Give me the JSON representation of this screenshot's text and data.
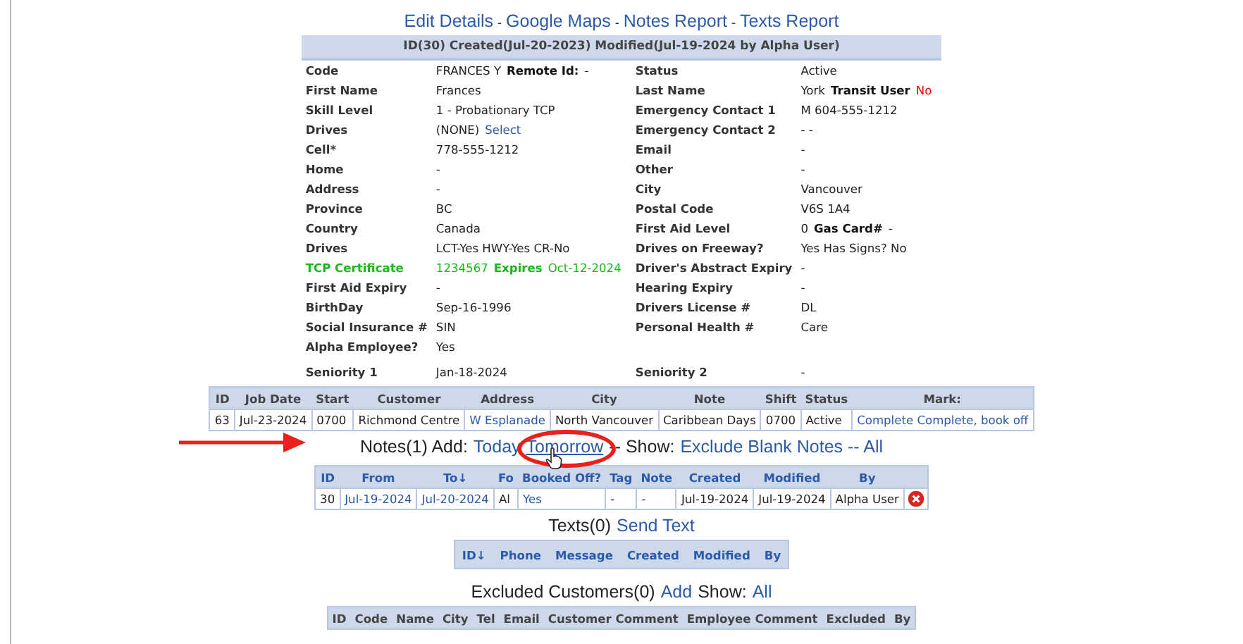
{
  "top_links": [
    "Edit Details",
    "Google Maps",
    "Notes Report",
    "Texts Report"
  ],
  "link_separator": "-",
  "detail": {
    "header": "ID(30) Created(Jul-20-2023) Modified(Jul-19-2024 by Alpha User)",
    "rows": [
      {
        "fields": [
          {
            "label": "Code",
            "highlight": false,
            "parts": [
              {
                "text": "FRANCES Y",
                "kind": "plain"
              },
              {
                "text": "Remote Id:",
                "kind": "bold"
              },
              {
                "text": "-",
                "kind": "plain"
              }
            ]
          },
          {
            "label": "Status",
            "highlight": false,
            "parts": [
              {
                "text": "Active",
                "kind": "plain"
              }
            ]
          }
        ]
      },
      {
        "fields": [
          {
            "label": "First Name",
            "highlight": false,
            "parts": [
              {
                "text": "Frances",
                "kind": "plain"
              }
            ]
          },
          {
            "label": "Last Name",
            "highlight": false,
            "parts": [
              {
                "text": "York",
                "kind": "plain"
              },
              {
                "text": "Transit User",
                "kind": "bold"
              },
              {
                "text": "No",
                "kind": "alert"
              }
            ]
          }
        ]
      },
      {
        "fields": [
          {
            "label": "Skill Level",
            "highlight": false,
            "parts": [
              {
                "text": "1 - Probationary TCP",
                "kind": "plain"
              }
            ]
          },
          {
            "label": "Emergency Contact 1",
            "highlight": false,
            "parts": [
              {
                "text": "M 604-555-1212",
                "kind": "plain"
              }
            ]
          }
        ]
      },
      {
        "fields": [
          {
            "label": "Drives",
            "highlight": false,
            "parts": [
              {
                "text": "(NONE)",
                "kind": "plain"
              },
              {
                "text": "Select",
                "kind": "link"
              }
            ]
          },
          {
            "label": "Emergency Contact 2",
            "highlight": false,
            "parts": [
              {
                "text": "- -",
                "kind": "plain"
              }
            ]
          }
        ]
      },
      {
        "fields": [
          {
            "label": "Cell*",
            "highlight": false,
            "parts": [
              {
                "text": "778-555-1212",
                "kind": "plain"
              }
            ]
          },
          {
            "label": "Email",
            "highlight": false,
            "parts": [
              {
                "text": "-",
                "kind": "plain"
              }
            ]
          }
        ]
      },
      {
        "fields": [
          {
            "label": "Home",
            "highlight": false,
            "parts": [
              {
                "text": "-",
                "kind": "plain"
              }
            ]
          },
          {
            "label": "Other",
            "highlight": false,
            "parts": [
              {
                "text": "-",
                "kind": "plain"
              }
            ]
          }
        ]
      },
      {
        "fields": [
          {
            "label": "Address",
            "highlight": false,
            "parts": [
              {
                "text": "-",
                "kind": "plain"
              }
            ]
          },
          {
            "label": "City",
            "highlight": false,
            "parts": [
              {
                "text": "Vancouver",
                "kind": "plain"
              }
            ]
          }
        ]
      },
      {
        "fields": [
          {
            "label": "Province",
            "highlight": false,
            "parts": [
              {
                "text": "BC",
                "kind": "plain"
              }
            ]
          },
          {
            "label": "Postal Code",
            "highlight": false,
            "parts": [
              {
                "text": "V6S 1A4",
                "kind": "plain"
              }
            ]
          }
        ]
      },
      {
        "fields": [
          {
            "label": "Country",
            "highlight": false,
            "parts": [
              {
                "text": "Canada",
                "kind": "plain"
              }
            ]
          },
          {
            "label": "First Aid Level",
            "highlight": false,
            "parts": [
              {
                "text": "0",
                "kind": "plain"
              },
              {
                "text": "Gas Card#",
                "kind": "bold"
              },
              {
                "text": "-",
                "kind": "plain"
              }
            ]
          }
        ]
      },
      {
        "fields": [
          {
            "label": "Drives",
            "highlight": false,
            "parts": [
              {
                "text": "LCT-Yes HWY-Yes CR-No",
                "kind": "plain"
              }
            ]
          },
          {
            "label": "Drives on Freeway?",
            "highlight": false,
            "parts": [
              {
                "text": "Yes Has Signs? No",
                "kind": "plain"
              }
            ]
          }
        ]
      },
      {
        "fields": [
          {
            "label": "TCP Certificate",
            "highlight": true,
            "parts": [
              {
                "text": "1234567",
                "kind": "plain"
              },
              {
                "text": "Expires",
                "kind": "bold"
              },
              {
                "text": "Oct-12-2024",
                "kind": "plain"
              }
            ]
          },
          {
            "label": "Driver's Abstract Expiry",
            "highlight": false,
            "parts": [
              {
                "text": "-",
                "kind": "plain"
              }
            ]
          }
        ]
      },
      {
        "fields": [
          {
            "label": "First Aid Expiry",
            "highlight": false,
            "parts": [
              {
                "text": "-",
                "kind": "plain"
              }
            ]
          },
          {
            "label": "Hearing Expiry",
            "highlight": false,
            "parts": [
              {
                "text": "-",
                "kind": "plain"
              }
            ]
          }
        ]
      },
      {
        "fields": [
          {
            "label": "BirthDay",
            "highlight": false,
            "parts": [
              {
                "text": "Sep-16-1996",
                "kind": "plain"
              }
            ]
          },
          {
            "label": "Drivers License #",
            "highlight": false,
            "parts": [
              {
                "text": "DL",
                "kind": "plain"
              }
            ]
          }
        ]
      },
      {
        "fields": [
          {
            "label": "Social Insurance #",
            "highlight": false,
            "parts": [
              {
                "text": "SIN",
                "kind": "plain"
              }
            ]
          },
          {
            "label": "Personal Health #",
            "highlight": false,
            "parts": [
              {
                "text": "Care",
                "kind": "plain"
              }
            ]
          }
        ]
      },
      {
        "fields": [
          {
            "label": "Alpha Employee?",
            "highlight": false,
            "parts": [
              {
                "text": "Yes",
                "kind": "plain"
              }
            ]
          }
        ]
      },
      {
        "spaced": true,
        "fields": [
          {
            "label": "Seniority 1",
            "highlight": false,
            "parts": [
              {
                "text": "Jan-18-2024",
                "kind": "plain"
              }
            ]
          },
          {
            "label": "Seniority 2",
            "highlight": false,
            "parts": [
              {
                "text": "-",
                "kind": "plain"
              }
            ]
          }
        ]
      }
    ]
  },
  "jobs": {
    "link_header": false,
    "columns": [
      "ID",
      "Job Date",
      "Start",
      "Customer",
      "Address",
      "City",
      "Note",
      "Shift",
      "Status",
      "Mark:"
    ],
    "rows": [
      {
        "cells": [
          {
            "text": "63",
            "link": false
          },
          {
            "text": "Jul-23-2024",
            "link": false
          },
          {
            "text": "0700",
            "link": false
          },
          {
            "text": "Richmond Centre",
            "link": false
          },
          {
            "text": "W Esplanade",
            "link": true
          },
          {
            "text": "North Vancouver",
            "link": false
          },
          {
            "text": "Caribbean Days",
            "link": false
          },
          {
            "text": "0700",
            "link": false
          },
          {
            "text": "Active",
            "link": false
          },
          {
            "text": "Complete Complete, book off",
            "link": true
          }
        ]
      }
    ]
  },
  "notes": {
    "heading": [
      {
        "text": "Notes(1) Add:",
        "kind": "plain"
      },
      {
        "text": "Today",
        "kind": "link"
      },
      {
        "text": "Tomorrow",
        "kind": "hover"
      },
      {
        "text": "-- Show:",
        "kind": "plain"
      },
      {
        "text": "Exclude Blank Notes -- All",
        "kind": "link"
      }
    ],
    "table": {
      "link_header": true,
      "columns": [
        "ID",
        "From",
        "To↓",
        "Fo",
        "Booked Off?",
        "Tag",
        "Note",
        "Created",
        "Modified",
        "By"
      ],
      "rows": [
        {
          "deletable": true,
          "cells": [
            {
              "text": "30",
              "link": false
            },
            {
              "text": "Jul-19-2024",
              "link": true
            },
            {
              "text": "Jul-20-2024",
              "link": true
            },
            {
              "text": "Al",
              "link": false
            },
            {
              "text": "Yes",
              "link": true
            },
            {
              "text": "-",
              "link": false
            },
            {
              "text": "-",
              "link": false
            },
            {
              "text": "Jul-19-2024",
              "link": false
            },
            {
              "text": "Jul-19-2024",
              "link": false
            },
            {
              "text": "Alpha User",
              "link": false
            }
          ]
        }
      ]
    }
  },
  "texts": {
    "heading": [
      {
        "text": "Texts(0)",
        "kind": "plain"
      },
      {
        "text": "Send Text",
        "kind": "link"
      }
    ],
    "table": {
      "link_header": true,
      "columns": [
        "ID↓",
        "Phone",
        "Message",
        "Created",
        "Modified",
        "By"
      ]
    }
  },
  "excluded": {
    "heading": [
      {
        "text": "Excluded Customers(0)",
        "kind": "plain"
      },
      {
        "text": "Add",
        "kind": "link"
      },
      {
        "text": "Show:",
        "kind": "plain"
      },
      {
        "text": "All",
        "kind": "link"
      }
    ],
    "table": {
      "link_header": false,
      "columns": [
        "ID",
        "Code",
        "Name",
        "City",
        "Tel",
        "Email",
        "Customer Comment",
        "Employee Comment",
        "Excluded",
        "By"
      ]
    }
  }
}
